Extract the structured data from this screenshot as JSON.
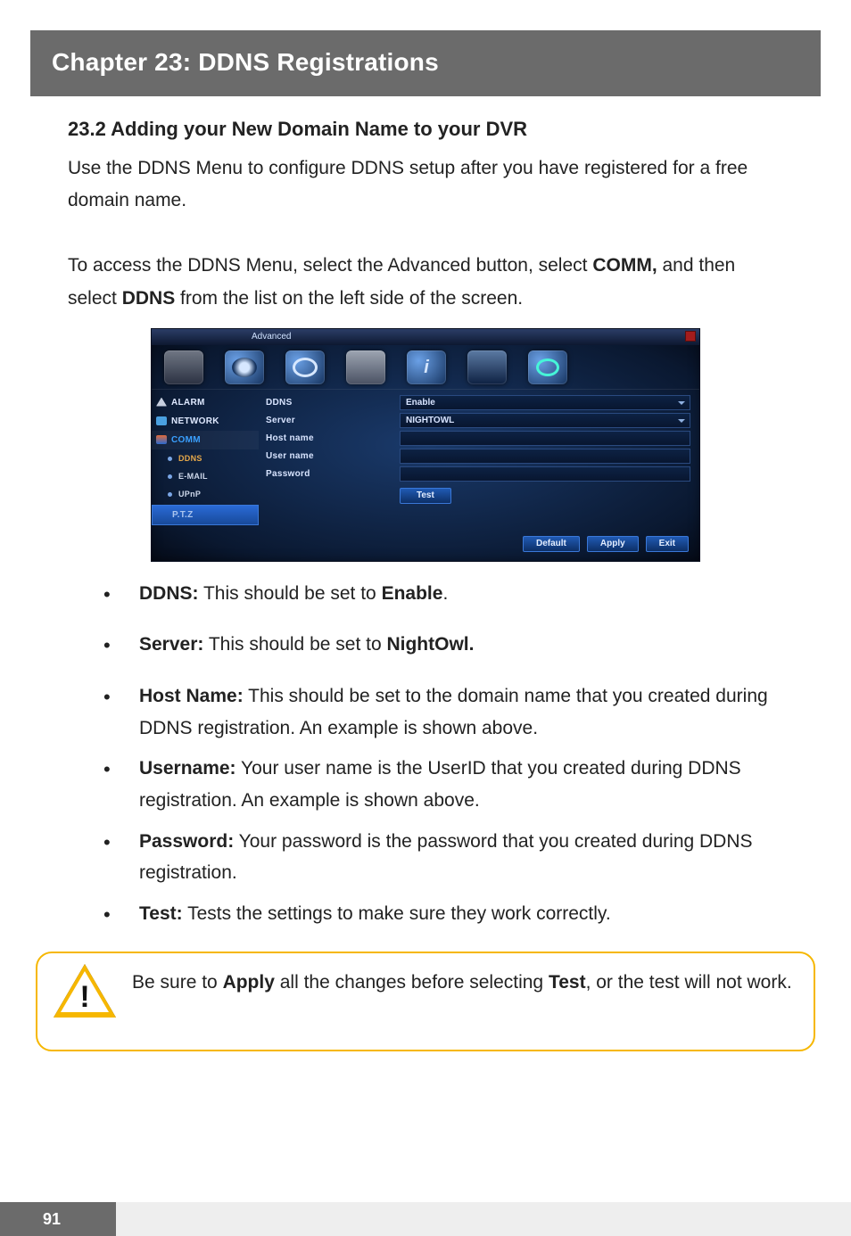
{
  "chapter": {
    "title": "Chapter 23: DDNS Registrations"
  },
  "section": {
    "heading": "23.2 Adding your New Domain Name to your DVR"
  },
  "para1": "Use the DDNS Menu to configure DDNS setup after you have registered for a free domain name.",
  "para2_prefix": "To access the DDNS Menu, select the Advanced button, select ",
  "para2_comm": "COMM,",
  "para2_mid": " and then select ",
  "para2_ddns": "DDNS",
  "para2_suffix": " from the list on the left side of the screen.",
  "dvr": {
    "title": "Advanced",
    "side": {
      "alarm": "ALARM",
      "network": "NETWORK",
      "comm": "COMM",
      "ddns": "DDNS",
      "email": "E-MAIL",
      "upnp": "UPnP",
      "ptz": "P.T.Z"
    },
    "form": {
      "ddns_label": "DDNS",
      "ddns_value": "Enable",
      "server_label": "Server",
      "server_value": "NIGHTOWL",
      "host_label": "Host name",
      "user_label": "User name",
      "pass_label": "Password",
      "test_btn": "Test"
    },
    "footer": {
      "default": "Default",
      "apply": "Apply",
      "exit": "Exit"
    }
  },
  "bullets": {
    "b1_key": "DDNS:",
    "b1_txt": " This should be set to ",
    "b1_val": "Enable",
    "b1_end": ".",
    "b2_key": "Server:",
    "b2_txt": " This should be set to ",
    "b2_val": "NightOwl.",
    "b3_key": "Host Name:",
    "b3_txt": " This should be set to the domain name that you created during DDNS registration. An example is shown above.",
    "b4_key": "Username:",
    "b4_txt": " Your user name is the UserID that you created during DDNS registration. An example is shown above.",
    "b5_key": "Password:",
    "b5_txt": " Your password is the password that you created during DDNS registration.",
    "b6_key": "Test:",
    "b6_txt": " Tests the settings to make sure they work correctly."
  },
  "caution": {
    "pre": "Be sure to ",
    "apply": "Apply",
    "mid": " all the changes before selecting ",
    "test": "Test",
    "post": ", or the test will not work."
  },
  "page_number": "91"
}
